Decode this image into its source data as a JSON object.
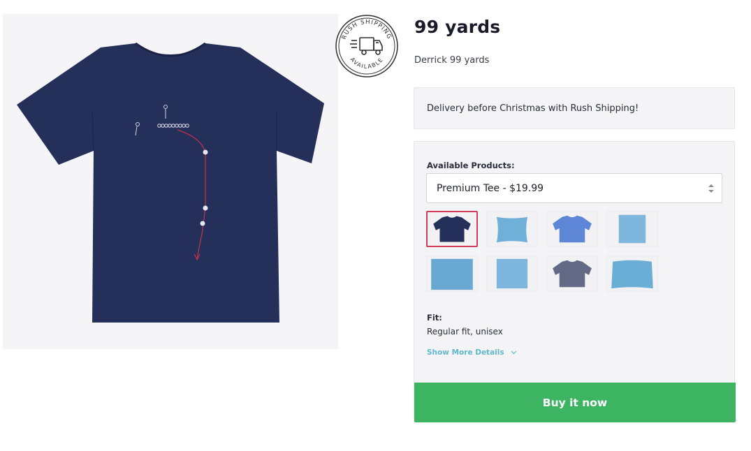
{
  "product": {
    "title": "99 yards",
    "subtitle": "Derrick 99 yards",
    "badge_text_top": "RUSH SHIPPING",
    "badge_text_bottom": "AVAILABLE",
    "badge_icon": "delivery-truck-icon"
  },
  "delivery": {
    "text": "Delivery before Christmas with Rush Shipping!"
  },
  "products": {
    "label": "Available Products:",
    "selected": "Premium Tee - $19.99",
    "select_icon": "sort-arrows-icon",
    "thumbnails": [
      {
        "name": "navy-tee",
        "color": "#25305a",
        "active": true
      },
      {
        "name": "pillow",
        "color": "#6fb0d8",
        "active": false
      },
      {
        "name": "blue-tee",
        "color": "#5e86d6",
        "active": false
      },
      {
        "name": "poster",
        "color": "#7db7de",
        "active": false
      },
      {
        "name": "tapestry",
        "color": "#6aa8d4",
        "active": false
      },
      {
        "name": "print",
        "color": "#7db7de",
        "active": false
      },
      {
        "name": "gray-tee",
        "color": "#636a86",
        "active": false
      },
      {
        "name": "blanket",
        "color": "#6aaed6",
        "active": false
      }
    ]
  },
  "fit": {
    "label": "Fit:",
    "value": "Regular fit, unisex"
  },
  "details": {
    "toggle_label": "Show More Details",
    "icon": "chevron-down-icon"
  },
  "buy": {
    "label": "Buy it now",
    "color": "#3db461"
  },
  "colors": {
    "accent_active": "#d23a5b",
    "link": "#5fb8c9",
    "shirt": "#25305a"
  }
}
